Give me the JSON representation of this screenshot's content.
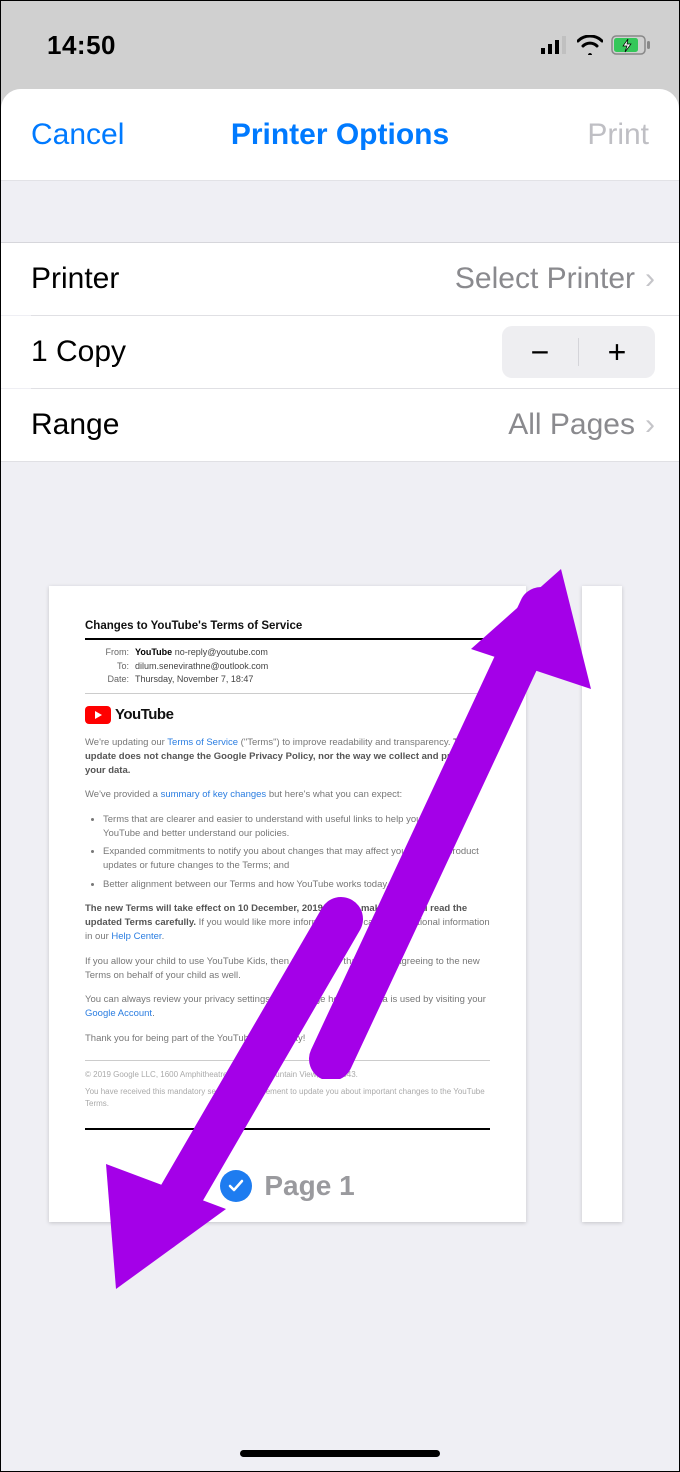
{
  "status": {
    "time": "14:50"
  },
  "nav": {
    "cancel": "Cancel",
    "title": "Printer Options",
    "print": "Print"
  },
  "cells": {
    "printer_label": "Printer",
    "printer_value": "Select Printer",
    "copies_label": "1 Copy",
    "range_label": "Range",
    "range_value": "All Pages"
  },
  "preview": {
    "page_label": "Page 1",
    "doc": {
      "title": "Changes to YouTube's Terms of Service",
      "from_key": "From:",
      "from_name": "YouTube",
      "from_email": "no-reply@youtube.com",
      "to_key": "To:",
      "to_val": "dilum.senevirathne@outlook.com",
      "date_key": "Date:",
      "date_val": "Thursday, November 7, 18:47",
      "brand": "YouTube",
      "p1a": "We're updating our ",
      "p1_link1": "Terms of Service",
      "p1b": " (\"Terms\") to improve readability and transparency. ",
      "p1_bold": "This update does not change the ",
      "p1_link2": "Google Privacy Policy",
      "p1_bold2": ", nor the way we collect and process your data.",
      "p2a": "We've provided a ",
      "p2_link": "summary of key changes",
      "p2b": " but here's what you can expect:",
      "b1": "Terms that are clearer and easier to understand with useful links to help you navigate YouTube and better understand our policies.",
      "b2": "Expanded commitments to notify you about changes that may affect you, such as product updates or future changes to the Terms; and",
      "b3": "Better alignment between our Terms and how YouTube works today.",
      "p3a": "The new Terms will take effect on 10 December, 2019. Please make sure you read the ",
      "p3_link": "updated Terms",
      "p3b": " carefully.",
      "p3c": " If you would like more information, you can find additional information in our ",
      "p3_link2": "Help Center",
      "p3d": ".",
      "p4": "If you allow your child to use YouTube Kids, then please note that you are agreeing to the new Terms on behalf of your child as well.",
      "p5a": "You can always review your privacy settings and manage how your data is used by visiting your ",
      "p5_link": "Google Account",
      "p5b": ".",
      "p6": "Thank you for being part of the YouTube community!",
      "f1": "© 2019 Google LLC, 1600 Amphitheatre Parkway, Mountain View, CA 94043.",
      "f2": "You have received this mandatory service announcement to update you about important changes to the YouTube Terms."
    }
  },
  "annotation": {
    "arrow_color": "#a400e8"
  }
}
